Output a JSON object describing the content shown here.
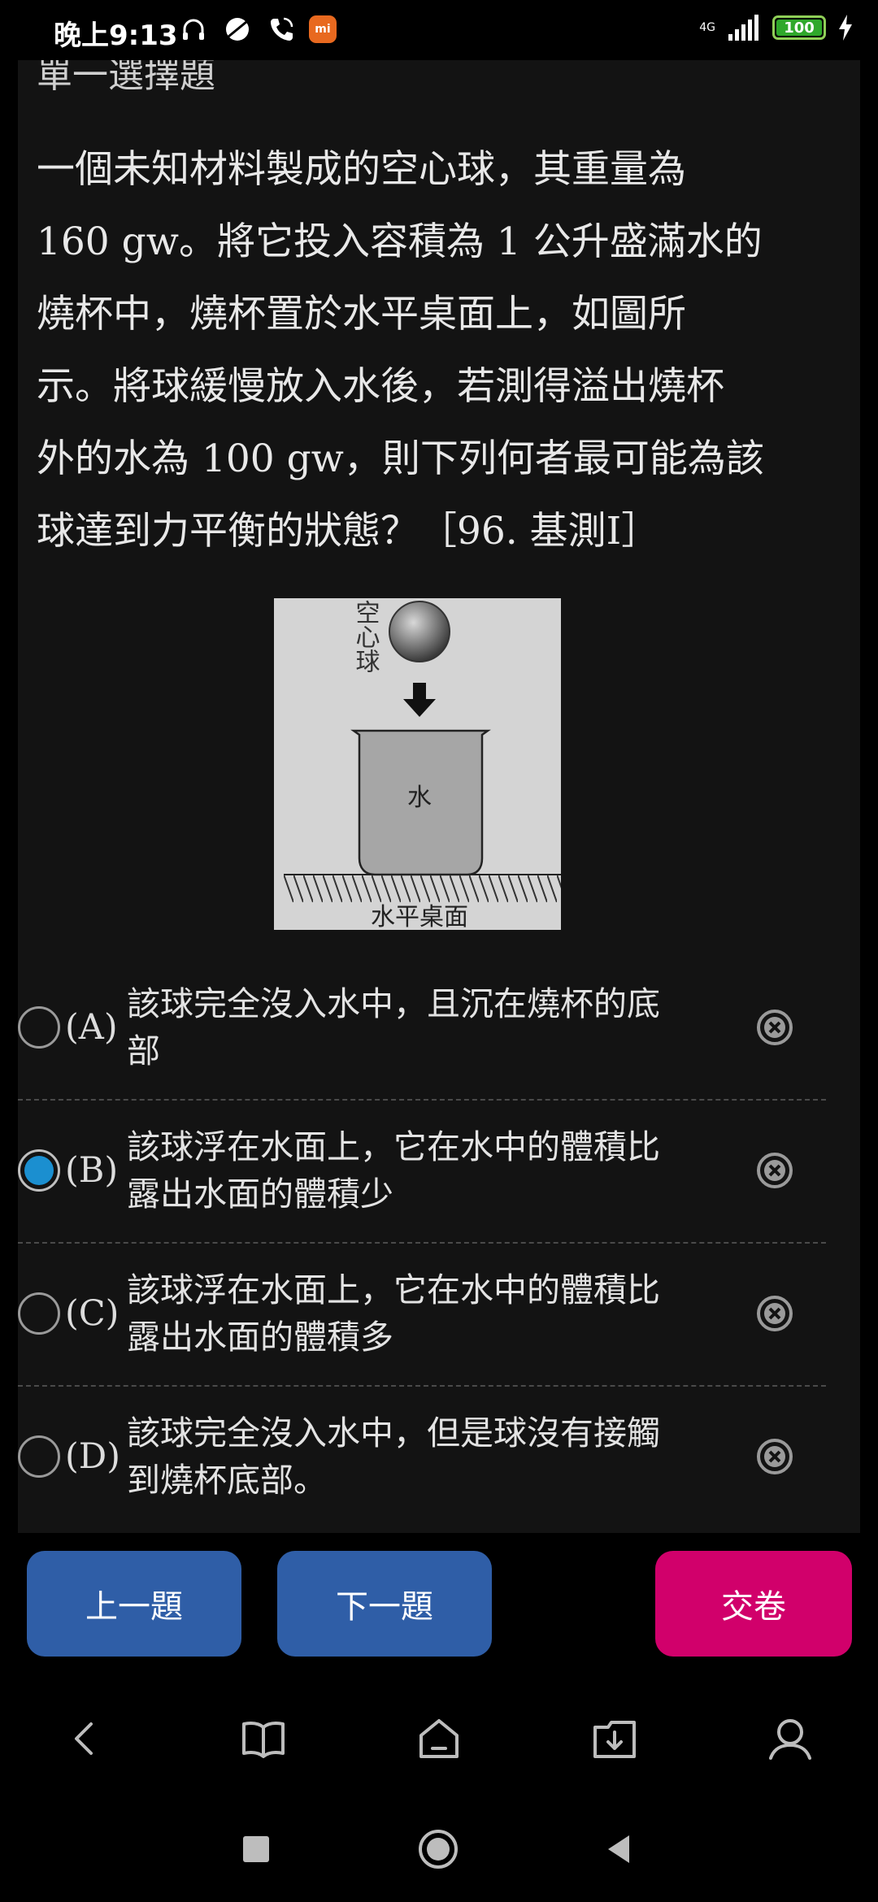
{
  "status_bar": {
    "time": "晚上9:13",
    "network": "4G",
    "battery": "100",
    "mi_badge": "mi"
  },
  "section_title": "單一選擇題",
  "question": {
    "lines": [
      "一個未知材料製成的空心球，其重量為",
      "160 gw。將它投入容積為 1 公升盛滿水的",
      "燒杯中，燒杯置於水平桌面上，如圖所",
      "示。將球緩慢放入水後，若測得溢出燒杯",
      "外的水為 100 gw，則下列何者最可能為該",
      "球達到力平衡的狀態？［96. 基測Ⅰ］"
    ]
  },
  "figure": {
    "ball_label": "空心球",
    "water_label": "水",
    "table_label": "水平桌面"
  },
  "options": [
    {
      "letter": "(A)",
      "line1": "該球完全沒入水中，且沉在燒杯的底",
      "line2": "部",
      "selected": false
    },
    {
      "letter": "(B)",
      "line1": "該球浮在水面上，它在水中的體積比",
      "line2": "露出水面的體積少",
      "selected": true
    },
    {
      "letter": "(C)",
      "line1": "該球浮在水面上，它在水中的體積比",
      "line2": "露出水面的體積多",
      "selected": false
    },
    {
      "letter": "(D)",
      "line1": "該球完全沒入水中，但是球沒有接觸",
      "line2": "到燒杯底部。",
      "selected": false
    }
  ],
  "buttons": {
    "prev": "上一題",
    "next": "下一題",
    "submit": "交卷"
  },
  "colors": {
    "accent_blue": "#2f5ea7",
    "submit_pink": "#d1006b",
    "radio_selected": "#1b8fd0"
  },
  "toolbar_icons": [
    "back-icon",
    "book-icon",
    "home-icon",
    "download-icon",
    "profile-icon"
  ],
  "system_nav_icons": [
    "recents-icon",
    "home-circle-icon",
    "back-triangle-icon"
  ]
}
